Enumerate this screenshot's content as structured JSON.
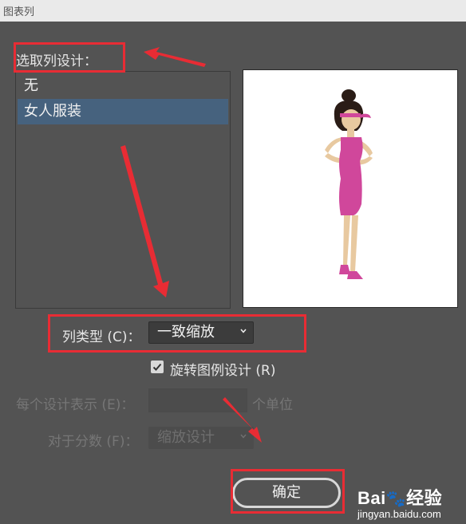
{
  "window": {
    "title": "图表列"
  },
  "design_section": {
    "label": "选取列设计：",
    "items": [
      {
        "label": "无",
        "selected": false
      },
      {
        "label": "女人服装",
        "selected": true
      }
    ]
  },
  "column_type": {
    "label": "列类型 (C)：",
    "value": "一致缩放"
  },
  "rotate_legend": {
    "label": "旋转图例设计 (R)",
    "checked": true
  },
  "each_design": {
    "label": "每个设计表示 (E)：",
    "value": "",
    "unit": "个单位"
  },
  "fraction": {
    "label": "对于分数 (F)：",
    "value": "缩放设计"
  },
  "ok_button": {
    "label": "确定"
  },
  "watermark": {
    "brand": "Bai",
    "brand_suffix": "经验",
    "url": "jingyan.baidu.com"
  },
  "colors": {
    "annotation": "#e82c34",
    "selection": "#46627e",
    "dress": "#d0479b"
  }
}
